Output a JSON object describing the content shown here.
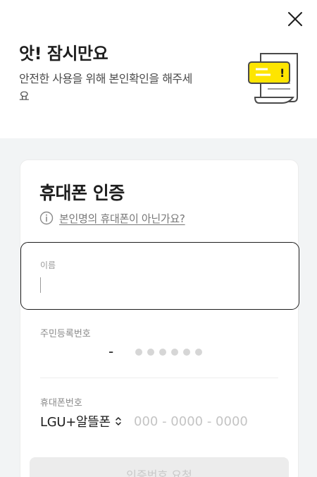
{
  "header": {
    "title": "앗! 잠시만요",
    "subtitle": "안전한 사용을 위해 본인확인을 해주세요",
    "close_icon": "close-icon",
    "illustration": "document-alert-icon",
    "illustration_mark": "!"
  },
  "card": {
    "title": "휴대폰 인증",
    "help_link": "본인명의 휴대폰이 아닌가요?",
    "help_icon": "info-icon"
  },
  "form": {
    "name": {
      "label": "이름",
      "value": ""
    },
    "rrn": {
      "label": "주민등록번호",
      "separator": "-",
      "masked_digits": 6
    },
    "phone": {
      "label": "휴대폰번호",
      "carrier": "LGU+알뜰폰",
      "carrier_icon": "updown-chevron-icon",
      "placeholder": "000 - 0000 - 0000"
    }
  },
  "submit": {
    "label": "인증번호 요청"
  },
  "colors": {
    "accent_yellow": "#fee500",
    "background_gray": "#f2f4f5",
    "text_primary": "#1e1e1e"
  }
}
